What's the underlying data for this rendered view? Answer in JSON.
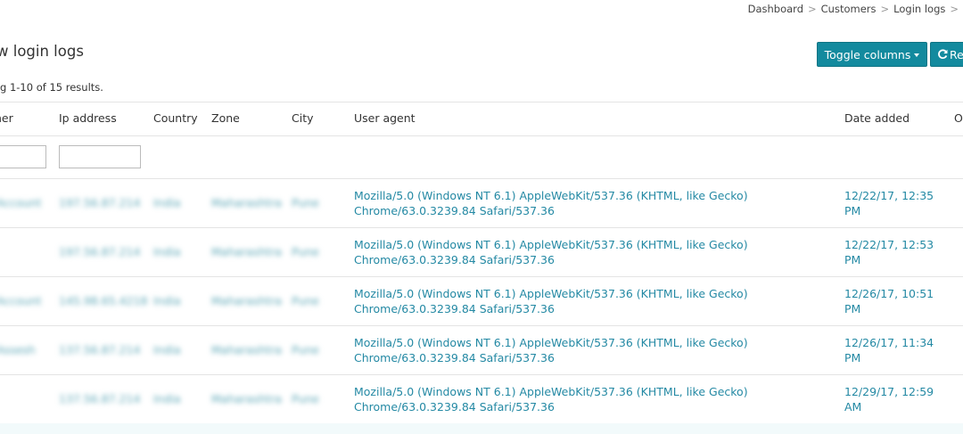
{
  "breadcrumb": [
    "Dashboard",
    "Customers",
    "Login logs"
  ],
  "page_title": "w login logs",
  "summary": "g 1-10 of 15 results.",
  "buttons": {
    "toggle_columns": "Toggle columns",
    "refresh": "Re"
  },
  "columns": [
    "ner",
    "Ip address",
    "Country",
    "Zone",
    "City",
    "User agent",
    "Date added",
    "O"
  ],
  "rows": [
    {
      "customer": "Account",
      "ip": "197.56.87.214",
      "country": "India",
      "zone": "Maharashtra",
      "city": "Pune",
      "ua1": "Mozilla/5.0 (Windows NT 6.1) AppleWebKit/537.36 (KHTML, like Gecko)",
      "ua2": "Chrome/63.0.3239.84 Safari/537.36",
      "date1": "12/22/17, 12:35",
      "date2": "PM"
    },
    {
      "customer": "",
      "ip": "197.56.87.214",
      "country": "India",
      "zone": "Maharashtra",
      "city": "Pune",
      "ua1": "Mozilla/5.0 (Windows NT 6.1) AppleWebKit/537.36 (KHTML, like Gecko)",
      "ua2": "Chrome/63.0.3239.84 Safari/537.36",
      "date1": "12/22/17, 12:53",
      "date2": "PM"
    },
    {
      "customer": "Account",
      "ip": "145.98.65.4218",
      "country": "India",
      "zone": "Maharashtra",
      "city": "Pune",
      "ua1": "Mozilla/5.0 (Windows NT 6.1) AppleWebKit/537.36 (KHTML, like Gecko)",
      "ua2": "Chrome/63.0.3239.84 Safari/537.36",
      "date1": "12/26/17, 10:51",
      "date2": "PM"
    },
    {
      "customer": "Assesh",
      "ip": "137.56.87.214",
      "country": "India",
      "zone": "Maharashtra",
      "city": "Pune",
      "ua1": "Mozilla/5.0 (Windows NT 6.1) AppleWebKit/537.36 (KHTML, like Gecko)",
      "ua2": "Chrome/63.0.3239.84 Safari/537.36",
      "date1": "12/26/17, 11:34",
      "date2": "PM"
    },
    {
      "customer": "",
      "ip": "137.56.87.214",
      "country": "India",
      "zone": "Maharashtra",
      "city": "Pune",
      "ua1": "Mozilla/5.0 (Windows NT 6.1) AppleWebKit/537.36 (KHTML, like Gecko)",
      "ua2": "Chrome/63.0.3239.84 Safari/537.36",
      "date1": "12/29/17, 12:59",
      "date2": "AM"
    }
  ]
}
